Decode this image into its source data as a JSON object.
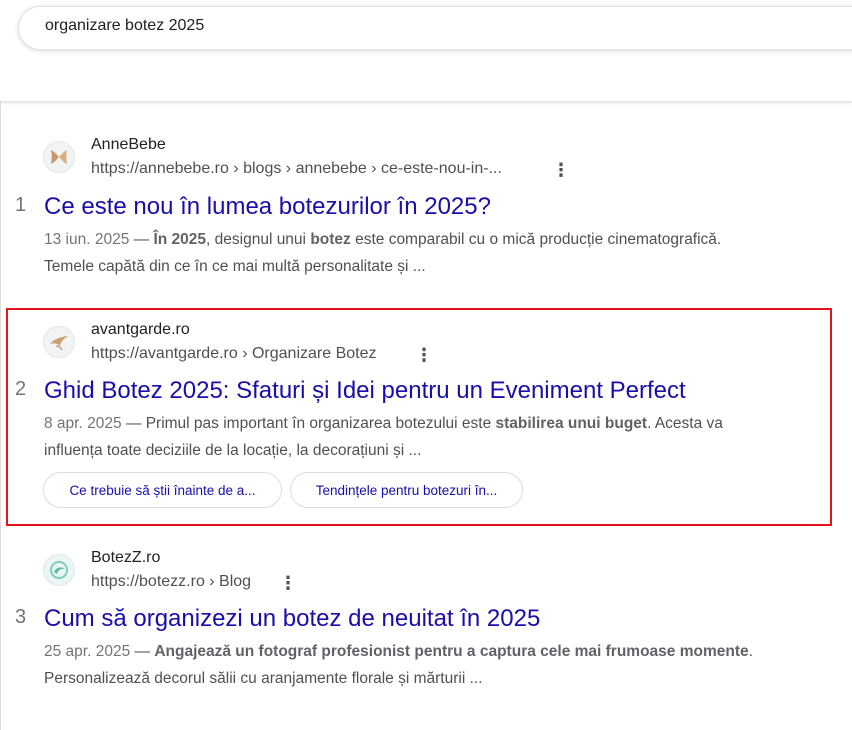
{
  "search": {
    "query": "organizare botez 2025"
  },
  "results": [
    {
      "rank": "1",
      "site_name": "AnneBebe",
      "url": "https://annebebe.ro › blogs › annebebe › ce-este-nou-in-...",
      "title": "Ce este nou în lumea botezurilor în 2025?",
      "snippet": {
        "date": "13 iun. 2025",
        "dash": " — ",
        "l1_a": "În ",
        "l1_b": "2025",
        "l1_c": ", designul unui ",
        "l1_d": "botez",
        "l1_e": " este comparabil cu o mică producție cinematografică.",
        "l2": "Temele capătă din ce în ce mai multă personalitate și ..."
      }
    },
    {
      "rank": "2",
      "site_name": "avantgarde.ro",
      "url": "https://avantgarde.ro › Organizare Botez",
      "title": "Ghid Botez 2025: Sfaturi și Idei pentru un Eveniment Perfect",
      "snippet": {
        "date": "8 apr. 2025",
        "dash": " — ",
        "l1_a": "Primul pas important în organizarea botezului este ",
        "l1_b": "stabilirea unui buget",
        "l1_c": ". Acesta va",
        "l2": "influența toate deciziile de la locație, la decorațiuni și ..."
      },
      "chips": [
        "Ce trebuie să știi înainte de a...",
        "Tendințele pentru botezuri în..."
      ]
    },
    {
      "rank": "3",
      "site_name": "BotezZ.ro",
      "url": "https://botezz.ro › Blog",
      "title": "Cum să organizezi un botez de neuitat în 2025",
      "snippet": {
        "date": "25 apr. 2025",
        "dash": " — ",
        "l1_a": "Angajează un fotograf profesionist pentru a captura cele mai frumoase momente",
        "l1_b": ".",
        "l2": "Personalizează decorul sălii cu aranjamente florale și mărturii ..."
      }
    }
  ],
  "colors": {
    "link": "#1a0dab",
    "highlight": "#e3121b",
    "text": "#202124",
    "secondary": "#4d5156"
  }
}
